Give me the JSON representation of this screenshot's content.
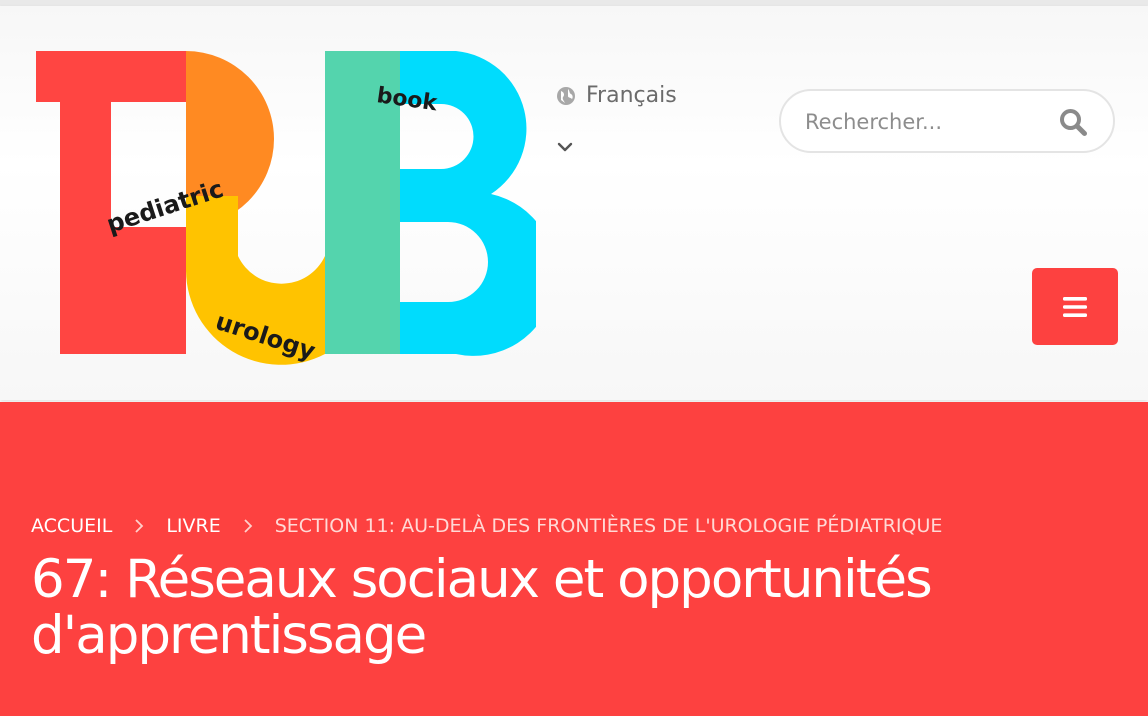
{
  "logo": {
    "big_letters": "PUB",
    "word_pediatric": "pediatric",
    "word_urology": "urology",
    "word_book": "book",
    "colors": {
      "red": "#ff4542",
      "orange": "#ff8a22",
      "yellow": "#ffc300",
      "green": "#54d4ad",
      "cyan": "#00dcfd"
    }
  },
  "language": {
    "current": "Français",
    "icon": "globe-icon",
    "caret_icon": "chevron-down-icon"
  },
  "search": {
    "placeholder": "Rechercher...",
    "icon": "search-icon"
  },
  "menu": {
    "icon": "hamburger-icon",
    "color": "#fd4140"
  },
  "breadcrumb": {
    "home": "ACCUEIL",
    "book": "LIVRE",
    "section": "SECTION 11: AU-DELÀ DES FRONTIÈRES DE L'UROLOGIE PÉDIATRIQUE"
  },
  "page": {
    "title": "67: Réseaux sociaux et opportunités d'apprentissage",
    "accent": "#fd4140"
  }
}
